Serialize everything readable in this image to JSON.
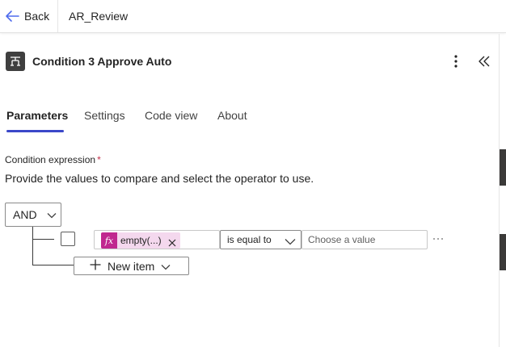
{
  "header": {
    "back_label": "Back",
    "flow_name": "AR_Review"
  },
  "action": {
    "icon": "condition-icon",
    "title": "Condition 3 Approve Auto"
  },
  "tabs": [
    {
      "label": "Parameters",
      "active": true
    },
    {
      "label": "Settings",
      "active": false
    },
    {
      "label": "Code view",
      "active": false
    },
    {
      "label": "About",
      "active": false
    }
  ],
  "condition": {
    "label": "Condition expression",
    "required_marker": "*",
    "description": "Provide the values to compare and select the operator to use.",
    "group_operator": "AND",
    "row": {
      "checked": false,
      "left_token": {
        "icon": "fx",
        "label": "empty(...)"
      },
      "operator": "is equal to",
      "right_value": "",
      "right_placeholder": "Choose a value"
    },
    "new_item_label": "New item"
  },
  "colors": {
    "accent": "#3b48c9",
    "token_background": "#f4d8ee",
    "token_icon": "#c0288f",
    "required": "#c4314b"
  }
}
